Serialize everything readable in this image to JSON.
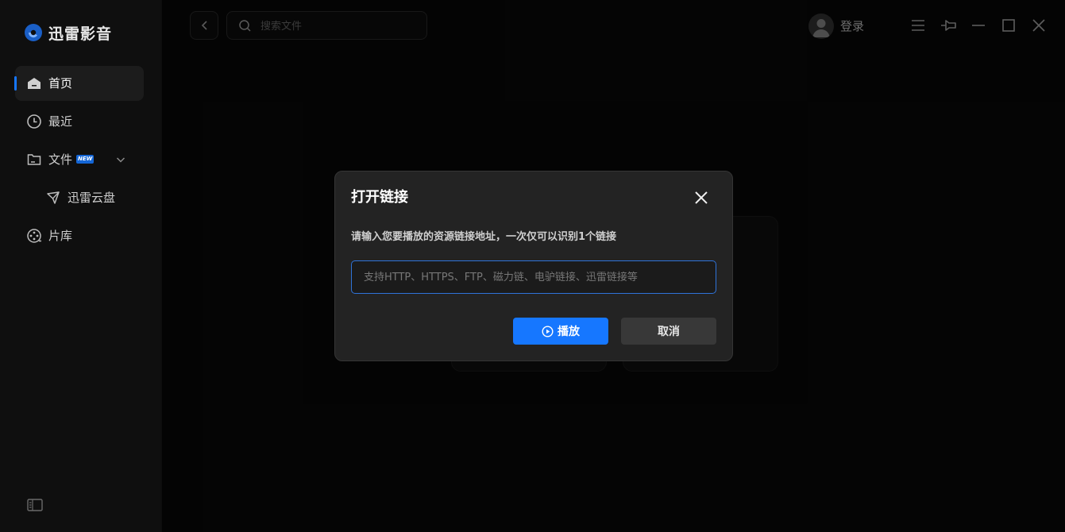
{
  "app": {
    "name": "迅雷影音"
  },
  "sidebar": {
    "items": [
      {
        "label": "首页",
        "icon": "home-icon",
        "active": true
      },
      {
        "label": "最近",
        "icon": "clock-icon",
        "active": false
      },
      {
        "label": "文件",
        "icon": "folder-icon",
        "active": false,
        "badge": "NEW"
      },
      {
        "label": "迅雷云盘",
        "icon": "cloud-drive-icon",
        "active": false
      },
      {
        "label": "片库",
        "icon": "film-reel-icon",
        "active": false
      }
    ]
  },
  "header": {
    "search_placeholder": "搜索文件",
    "login_label": "登录"
  },
  "dialog": {
    "title": "打开链接",
    "description": "请输入您要播放的资源链接地址，一次仅可以识别1个链接",
    "input_value": "",
    "input_placeholder": "支持HTTP、HTTPS、FTP、磁力链、电驴链接、迅雷链接等",
    "play_label": "播放",
    "cancel_label": "取消"
  },
  "colors": {
    "accent": "#1677ff",
    "background": "#070707",
    "sidebar": "#0f0f0f",
    "dialog": "#232323"
  }
}
